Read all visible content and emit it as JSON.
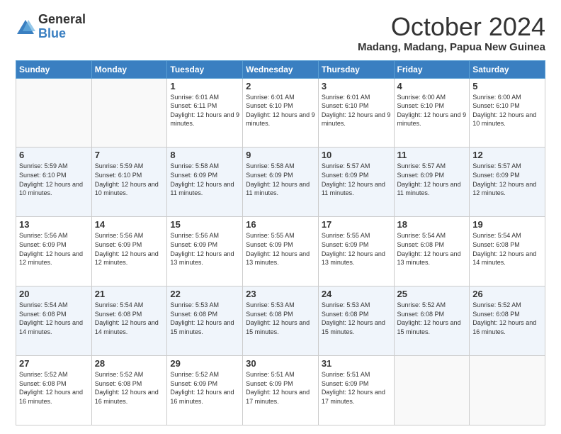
{
  "header": {
    "logo_general": "General",
    "logo_blue": "Blue",
    "month_title": "October 2024",
    "location": "Madang, Madang, Papua New Guinea"
  },
  "days_of_week": [
    "Sunday",
    "Monday",
    "Tuesday",
    "Wednesday",
    "Thursday",
    "Friday",
    "Saturday"
  ],
  "weeks": [
    [
      {
        "day": "",
        "info": ""
      },
      {
        "day": "",
        "info": ""
      },
      {
        "day": "1",
        "info": "Sunrise: 6:01 AM\nSunset: 6:11 PM\nDaylight: 12 hours and 9 minutes."
      },
      {
        "day": "2",
        "info": "Sunrise: 6:01 AM\nSunset: 6:10 PM\nDaylight: 12 hours and 9 minutes."
      },
      {
        "day": "3",
        "info": "Sunrise: 6:01 AM\nSunset: 6:10 PM\nDaylight: 12 hours and 9 minutes."
      },
      {
        "day": "4",
        "info": "Sunrise: 6:00 AM\nSunset: 6:10 PM\nDaylight: 12 hours and 9 minutes."
      },
      {
        "day": "5",
        "info": "Sunrise: 6:00 AM\nSunset: 6:10 PM\nDaylight: 12 hours and 10 minutes."
      }
    ],
    [
      {
        "day": "6",
        "info": "Sunrise: 5:59 AM\nSunset: 6:10 PM\nDaylight: 12 hours and 10 minutes."
      },
      {
        "day": "7",
        "info": "Sunrise: 5:59 AM\nSunset: 6:10 PM\nDaylight: 12 hours and 10 minutes."
      },
      {
        "day": "8",
        "info": "Sunrise: 5:58 AM\nSunset: 6:09 PM\nDaylight: 12 hours and 11 minutes."
      },
      {
        "day": "9",
        "info": "Sunrise: 5:58 AM\nSunset: 6:09 PM\nDaylight: 12 hours and 11 minutes."
      },
      {
        "day": "10",
        "info": "Sunrise: 5:57 AM\nSunset: 6:09 PM\nDaylight: 12 hours and 11 minutes."
      },
      {
        "day": "11",
        "info": "Sunrise: 5:57 AM\nSunset: 6:09 PM\nDaylight: 12 hours and 11 minutes."
      },
      {
        "day": "12",
        "info": "Sunrise: 5:57 AM\nSunset: 6:09 PM\nDaylight: 12 hours and 12 minutes."
      }
    ],
    [
      {
        "day": "13",
        "info": "Sunrise: 5:56 AM\nSunset: 6:09 PM\nDaylight: 12 hours and 12 minutes."
      },
      {
        "day": "14",
        "info": "Sunrise: 5:56 AM\nSunset: 6:09 PM\nDaylight: 12 hours and 12 minutes."
      },
      {
        "day": "15",
        "info": "Sunrise: 5:56 AM\nSunset: 6:09 PM\nDaylight: 12 hours and 13 minutes."
      },
      {
        "day": "16",
        "info": "Sunrise: 5:55 AM\nSunset: 6:09 PM\nDaylight: 12 hours and 13 minutes."
      },
      {
        "day": "17",
        "info": "Sunrise: 5:55 AM\nSunset: 6:09 PM\nDaylight: 12 hours and 13 minutes."
      },
      {
        "day": "18",
        "info": "Sunrise: 5:54 AM\nSunset: 6:08 PM\nDaylight: 12 hours and 13 minutes."
      },
      {
        "day": "19",
        "info": "Sunrise: 5:54 AM\nSunset: 6:08 PM\nDaylight: 12 hours and 14 minutes."
      }
    ],
    [
      {
        "day": "20",
        "info": "Sunrise: 5:54 AM\nSunset: 6:08 PM\nDaylight: 12 hours and 14 minutes."
      },
      {
        "day": "21",
        "info": "Sunrise: 5:54 AM\nSunset: 6:08 PM\nDaylight: 12 hours and 14 minutes."
      },
      {
        "day": "22",
        "info": "Sunrise: 5:53 AM\nSunset: 6:08 PM\nDaylight: 12 hours and 15 minutes."
      },
      {
        "day": "23",
        "info": "Sunrise: 5:53 AM\nSunset: 6:08 PM\nDaylight: 12 hours and 15 minutes."
      },
      {
        "day": "24",
        "info": "Sunrise: 5:53 AM\nSunset: 6:08 PM\nDaylight: 12 hours and 15 minutes."
      },
      {
        "day": "25",
        "info": "Sunrise: 5:52 AM\nSunset: 6:08 PM\nDaylight: 12 hours and 15 minutes."
      },
      {
        "day": "26",
        "info": "Sunrise: 5:52 AM\nSunset: 6:08 PM\nDaylight: 12 hours and 16 minutes."
      }
    ],
    [
      {
        "day": "27",
        "info": "Sunrise: 5:52 AM\nSunset: 6:08 PM\nDaylight: 12 hours and 16 minutes."
      },
      {
        "day": "28",
        "info": "Sunrise: 5:52 AM\nSunset: 6:08 PM\nDaylight: 12 hours and 16 minutes."
      },
      {
        "day": "29",
        "info": "Sunrise: 5:52 AM\nSunset: 6:09 PM\nDaylight: 12 hours and 16 minutes."
      },
      {
        "day": "30",
        "info": "Sunrise: 5:51 AM\nSunset: 6:09 PM\nDaylight: 12 hours and 17 minutes."
      },
      {
        "day": "31",
        "info": "Sunrise: 5:51 AM\nSunset: 6:09 PM\nDaylight: 12 hours and 17 minutes."
      },
      {
        "day": "",
        "info": ""
      },
      {
        "day": "",
        "info": ""
      }
    ]
  ]
}
